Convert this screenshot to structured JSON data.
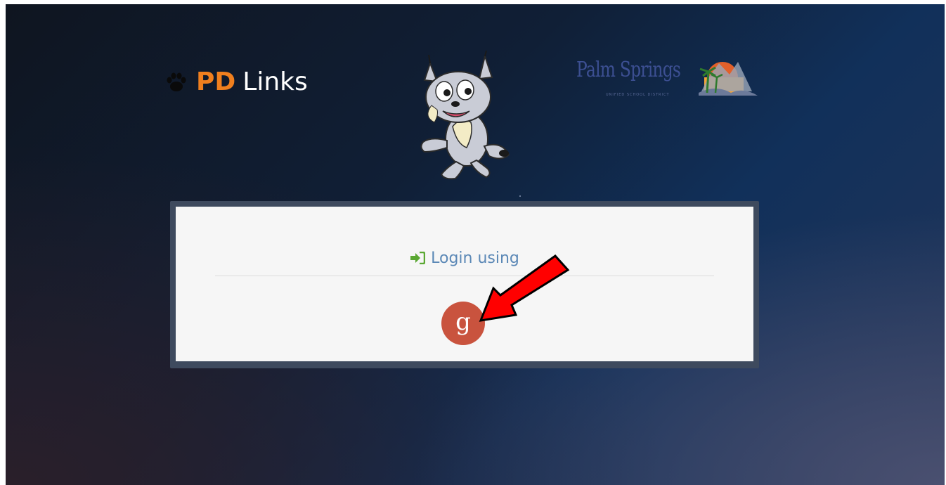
{
  "header": {
    "brand_prefix": "PD",
    "brand_suffix": "Links",
    "paw_icon": "paw-icon",
    "mascot": "bobcat-mascot",
    "district_logo": {
      "name": "Palm Springs",
      "subtitle": "UNIFIED SCHOOL DISTRICT"
    }
  },
  "login_card": {
    "heading": "Login using",
    "heading_icon": "sign-in-icon",
    "providers": [
      {
        "name": "google",
        "glyph": "g",
        "icon": "google-icon"
      }
    ]
  },
  "annotation": {
    "pointer": "red-arrow"
  },
  "colors": {
    "brand_orange": "#f07f1e",
    "login_text": "#5b88b6",
    "sign_in_icon": "#5aa832",
    "google_red": "#c9533e",
    "arrow_red": "#ff0000",
    "card_bg": "#f6f6f6",
    "card_border": "#3e4a5e"
  }
}
